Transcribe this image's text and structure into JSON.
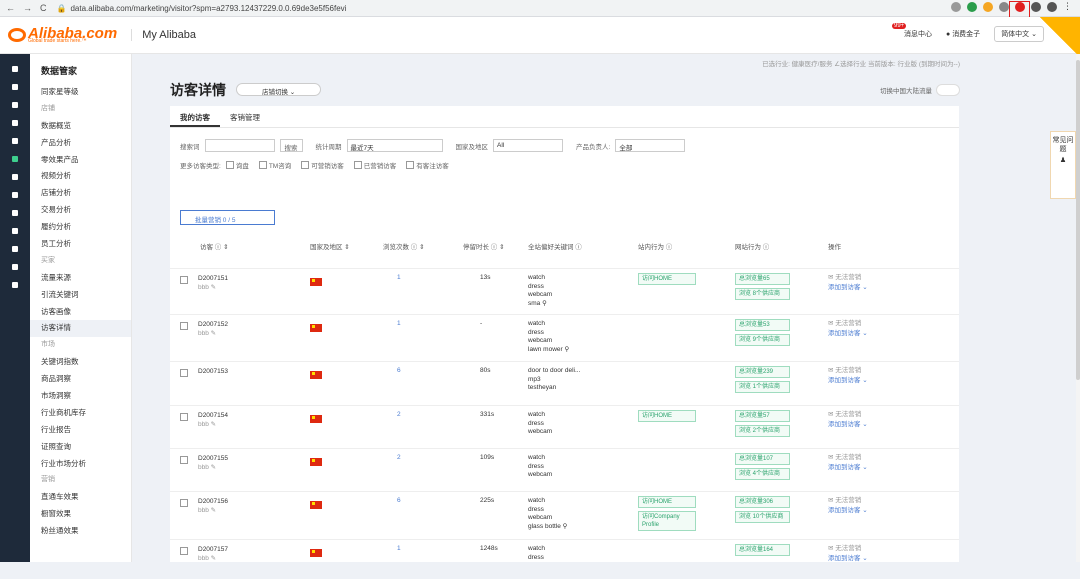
{
  "browser": {
    "url": "data.alibaba.com/marketing/visitor?spm=a2793.12437229.0.0.69de3e5f56fevi"
  },
  "header": {
    "logo": "Alibaba.com",
    "logo_tagline": "Global trade starts here.™",
    "title": "My Alibaba",
    "msg_count": "99+",
    "msg_center": "消息中心",
    "trade_assurance": "消费金子",
    "language": "简体中文"
  },
  "sidebar": {
    "title": "数据管家",
    "items": [
      "同家星等级",
      "店铺",
      "数据概览",
      "产品分析",
      "零效果产品",
      "视频分析",
      "店铺分析",
      "交易分析",
      "履约分析",
      "员工分析",
      "买家",
      "流量来源",
      "引流关键词",
      "访客画像",
      "访客详情",
      "市场",
      "关键词指数",
      "商品洞察",
      "市场洞察",
      "行业商机库存",
      "行业报告",
      "证照查询",
      "行业市场分析",
      "营销",
      "直通车效果",
      "橱窗效果",
      "粉丝通效果"
    ]
  },
  "page": {
    "breadcrumb": "已选行业: 健康医疗/服务 ∠选择行业    当前版本: 行业版 (到期时间为--)",
    "title": "访客详情",
    "shop_select": "店铺切换",
    "ai_toggle_label": "切换中国大陆流量"
  },
  "tabs": [
    "我的访客",
    "客销管理"
  ],
  "filters": {
    "search_label": "搜索词",
    "search_btn": "搜索",
    "period_label": "统计周期",
    "period_value": "最近7天",
    "region_label": "国家及地区",
    "region_value": "All",
    "owner_label": "产品负责人:",
    "owner_value": "全部",
    "more_label": "更多访客类型:",
    "checks": [
      "询盘",
      "TM咨询",
      "可营销访客",
      "已营销访客",
      "有客注访客"
    ]
  },
  "list": {
    "batch": "批量营销   0 / 5",
    "columns": [
      "访客 ⓘ ⇕",
      "国家及地区 ⇕",
      "浏览次数 ⓘ ⇕",
      "停留时长 ⓘ ⇕",
      "全站偏好关键词 ⓘ",
      "站内行为 ⓘ",
      "网站行为 ⓘ",
      "操作"
    ],
    "rows": [
      {
        "id": "D2007151",
        "sub": "bbb ✎",
        "visits": "1",
        "stay": "13s",
        "keywords": [
          "watch",
          "dress",
          "webcam",
          "sma ⚲"
        ],
        "onsite": [
          "访问HOME"
        ],
        "web": [
          "总浏览量65",
          "浏览 8个供应商"
        ],
        "op1": "✉ 无法营销",
        "op2": "添加到访客 ⌄"
      },
      {
        "id": "D2007152",
        "sub": "bbb ✎",
        "visits": "1",
        "stay": "-",
        "keywords": [
          "watch",
          "dress",
          "webcam",
          "lawn mower ⚲"
        ],
        "onsite": [],
        "web": [
          "总浏览量53",
          "浏览 9个供应商"
        ],
        "op1": "✉ 无法营销",
        "op2": "添加到访客 ⌄"
      },
      {
        "id": "D2007153",
        "sub": "",
        "visits": "6",
        "stay": "80s",
        "keywords": [
          "door to door deli...",
          "mp3",
          "testheyan"
        ],
        "onsite": [],
        "web": [
          "总浏览量239",
          "浏览 1个供应商"
        ],
        "op1": "✉ 无法营销",
        "op2": "添加到访客 ⌄"
      },
      {
        "id": "D2007154",
        "sub": "bbb ✎",
        "visits": "2",
        "stay": "331s",
        "keywords": [
          "watch",
          "dress",
          "webcam"
        ],
        "onsite": [
          "访问HOME"
        ],
        "web": [
          "总浏览量57",
          "浏览 2个供应商"
        ],
        "op1": "✉ 无法营销",
        "op2": "添加到访客 ⌄"
      },
      {
        "id": "D2007155",
        "sub": "bbb ✎",
        "visits": "2",
        "stay": "109s",
        "keywords": [
          "watch",
          "dress",
          "webcam"
        ],
        "onsite": [],
        "web": [
          "总浏览量107",
          "浏览 4个供应商"
        ],
        "op1": "✉ 无法营销",
        "op2": "添加到访客 ⌄"
      },
      {
        "id": "D2007156",
        "sub": "bbb ✎",
        "visits": "6",
        "stay": "225s",
        "keywords": [
          "watch",
          "dress",
          "webcam",
          "glass bottle ⚲"
        ],
        "onsite": [
          "访问HOME",
          "访问Company Profile"
        ],
        "web": [
          "总浏览量306",
          "浏览 10个供应商"
        ],
        "op1": "✉ 无法营销",
        "op2": "添加到访客 ⌄"
      },
      {
        "id": "D2007157",
        "sub": "bbb ✎",
        "visits": "1",
        "stay": "1248s",
        "keywords": [
          "watch",
          "dress"
        ],
        "onsite": [],
        "web": [
          "总浏览量164"
        ],
        "op1": "✉ 无法营销",
        "op2": "添加到访客 ⌄"
      }
    ]
  },
  "help": "常见问题"
}
